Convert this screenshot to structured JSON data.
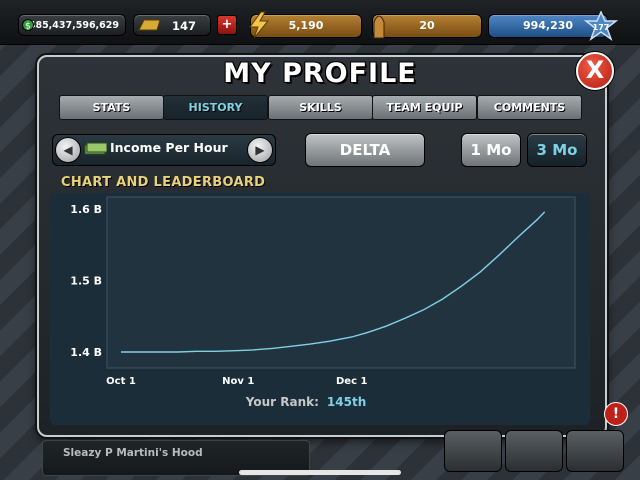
{
  "hud": {
    "cash": "$485,437,596,629",
    "gold": "147",
    "plus": "+",
    "energy": "5,190",
    "stamina": "20",
    "xp": "994,230",
    "level": "177"
  },
  "modal": {
    "title": "MY PROFILE",
    "close": "X",
    "tabs": [
      {
        "label": "STATS"
      },
      {
        "label": "HISTORY"
      },
      {
        "label": "SKILLS"
      },
      {
        "label": "TEAM EQUIP"
      },
      {
        "label": "COMMENTS"
      }
    ],
    "active_tab": "HISTORY",
    "selector_label": "Income Per Hour",
    "delta_label": "DELTA",
    "range_1mo": "1 Mo",
    "range_3mo": "3 Mo",
    "section_title": "CHART AND LEADERBOARD",
    "rank_label": "Your Rank:",
    "rank_value": "145th"
  },
  "bottom": {
    "hood_name": "Sleazy P Martini's Hood"
  },
  "colors": {
    "accent_cyan": "#7fd2e4",
    "section_yellow": "#e9d27a",
    "line": "#7fd2e4"
  },
  "chart_data": {
    "type": "line",
    "title": "",
    "xlabel": "",
    "ylabel": "",
    "x_ticks": [
      "Oct 1",
      "Nov 1",
      "Dec 1"
    ],
    "y_ticks": [
      "1.4 B",
      "1.5 B",
      "1.6 B"
    ],
    "ylim": [
      1.4,
      1.6
    ],
    "series": [
      {
        "points": [
          [
            0,
            1.4
          ],
          [
            5,
            1.4
          ],
          [
            10,
            1.4
          ],
          [
            15,
            1.4
          ],
          [
            20,
            1.401
          ],
          [
            25,
            1.401
          ],
          [
            31,
            1.402
          ],
          [
            35,
            1.403
          ],
          [
            40,
            1.405
          ],
          [
            45,
            1.408
          ],
          [
            50,
            1.411
          ],
          [
            55,
            1.415
          ],
          [
            61,
            1.421
          ],
          [
            65,
            1.427
          ],
          [
            70,
            1.436
          ],
          [
            75,
            1.447
          ],
          [
            80,
            1.459
          ],
          [
            85,
            1.474
          ],
          [
            90,
            1.492
          ],
          [
            95,
            1.512
          ],
          [
            100,
            1.536
          ],
          [
            105,
            1.561
          ],
          [
            110,
            1.585
          ],
          [
            112,
            1.596
          ]
        ]
      }
    ],
    "x_domain": [
      0,
      115
    ],
    "grid": false
  }
}
